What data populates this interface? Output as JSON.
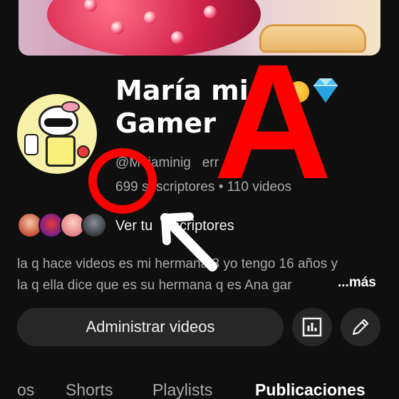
{
  "channel": {
    "name": "María mi\nGamer",
    "handle": "@Mariaminigamerr",
    "handle_visible": "@M  iaminig   err",
    "subscribers_text": "699 suscriptores",
    "separator": "•",
    "videos_text": "110 videos",
    "view_subscribers_label": "Ver tus suscriptores",
    "view_subscribers_visible": "Ver tu   uscriptores",
    "description_line1": "la q hace videos es mi hermana:3 yo tengo 16 años y",
    "description_line2": "la q ella dice que es su hermana q es Ana gar",
    "more_label": "...más"
  },
  "actions": {
    "manage_videos_label": "Administrar videos",
    "analytics_icon": "bar-chart-icon",
    "edit_icon": "pencil-icon"
  },
  "tabs": [
    {
      "label": "os",
      "active": false
    },
    {
      "label": "Shorts",
      "active": false
    },
    {
      "label": "Playlists",
      "active": false
    },
    {
      "label": "Publicaciones",
      "active": true
    }
  ],
  "overlay": {
    "big_letter": "A",
    "annotation_color": "#ff0000",
    "arrow_color": "#ffffff"
  }
}
